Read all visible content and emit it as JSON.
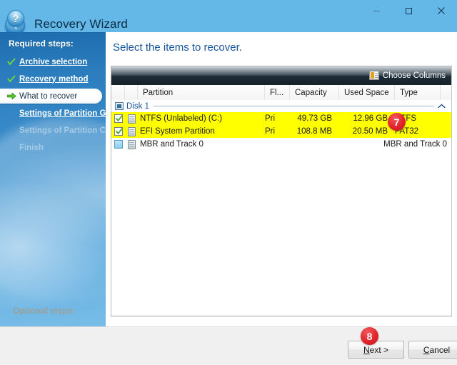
{
  "window": {
    "title": "Recovery Wizard",
    "back_icon": "back-arrow-icon",
    "minimize_label": "Minimize",
    "maximize_label": "Maximize",
    "close_label": "Close"
  },
  "sidebar": {
    "heading": "Required steps:",
    "optional_heading": "Optional steps:",
    "items": [
      {
        "label": "Archive selection",
        "state": "done",
        "icon": "check-icon"
      },
      {
        "label": "Recovery method",
        "state": "done",
        "icon": "check-icon"
      },
      {
        "label": "What to recover",
        "state": "active",
        "icon": "arrow-right-icon"
      },
      {
        "label": "Settings of Partition G",
        "state": "link",
        "icon": ""
      },
      {
        "label": "Settings of Partition C",
        "state": "disabled",
        "icon": ""
      },
      {
        "label": "Finish",
        "state": "disabled",
        "icon": ""
      }
    ]
  },
  "main": {
    "page_title": "Select the items to recover.",
    "toolbar": {
      "choose_columns_label": "Choose Columns",
      "choose_columns_icon": "columns-icon"
    },
    "table": {
      "columns": [
        "Partition",
        "Fl...",
        "Capacity",
        "Used Space",
        "Type"
      ],
      "group": {
        "label": "Disk 1",
        "icon": "disk-icon",
        "collapse_icon": "chevron-up-icon"
      },
      "rows": [
        {
          "checked": true,
          "selected": true,
          "icon": "partition-icon",
          "partition": "NTFS (Unlabeled) (C:)",
          "flags": "Pri",
          "capacity": "49.73 GB",
          "used_space": "12.96 GB",
          "type": "NTFS"
        },
        {
          "checked": true,
          "selected": true,
          "icon": "partition-icon",
          "partition": "EFI System Partition",
          "flags": "Pri",
          "capacity": "108.8 MB",
          "used_space": "20.50 MB",
          "type": "FAT32"
        },
        {
          "checked": false,
          "selected": false,
          "icon": "partition-icon",
          "partition": "MBR and Track 0",
          "flags": "",
          "capacity": "",
          "used_space": "",
          "type": "MBR and Track 0"
        }
      ]
    }
  },
  "footer": {
    "help_label": "?",
    "next_label": "Next >",
    "next_accel": "N",
    "next_rest": "ext >",
    "cancel_accel": "C",
    "cancel_rest": "ancel",
    "cancel_label": "Cancel"
  },
  "annotations": [
    {
      "id": "7",
      "text": "7"
    },
    {
      "id": "8",
      "text": "8"
    }
  ],
  "colors": {
    "accent": "#63b8e8",
    "sidebar_top": "#1d6dae",
    "title_text": "#0b2b44",
    "page_title": "#18559c",
    "selection": "#ffff00",
    "badge": "#e3262c"
  }
}
